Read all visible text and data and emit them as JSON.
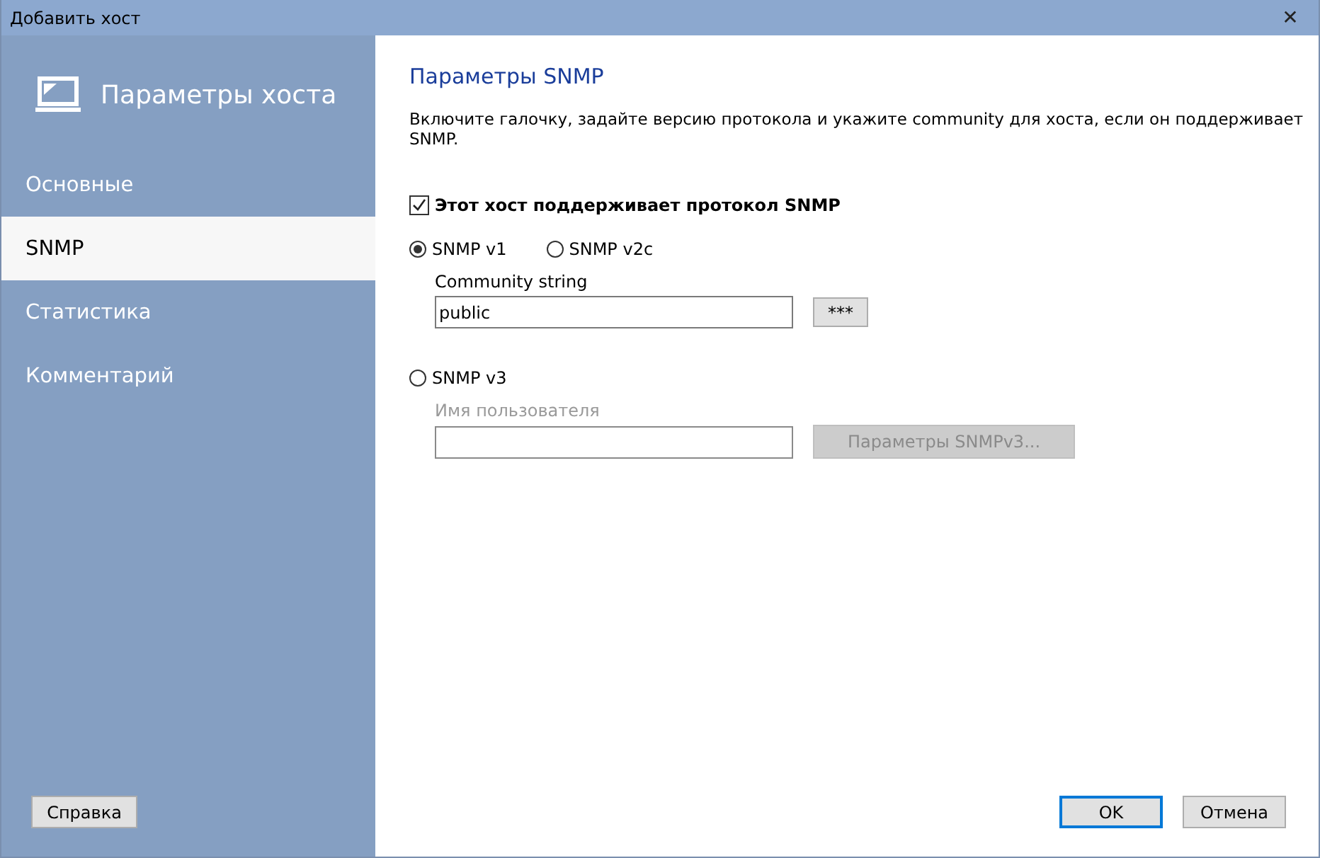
{
  "window": {
    "title": "Добавить хост",
    "close": "✕"
  },
  "sidebar": {
    "heading": "Параметры хоста",
    "items": [
      {
        "label": "Основные",
        "selected": false
      },
      {
        "label": "SNMP",
        "selected": true
      },
      {
        "label": "Статистика",
        "selected": false
      },
      {
        "label": "Комментарий",
        "selected": false
      }
    ],
    "help_button": "Справка"
  },
  "content": {
    "title": "Параметры SNMP",
    "description": "Включите галочку, задайте версию протокола и укажите community для хоста,  если он поддерживает SNMP.",
    "snmp_checkbox": {
      "label": "Этот хост поддерживает протокол SNMP",
      "checked": true
    },
    "versions": [
      {
        "label": "SNMP v1",
        "selected": true
      },
      {
        "label": "SNMP v2c",
        "selected": false
      },
      {
        "label": "SNMP v3",
        "selected": false
      }
    ],
    "community": {
      "label": "Community string",
      "value": "public",
      "disabled": false,
      "button": "***"
    },
    "user": {
      "label": "Имя пользователя",
      "disabled": true,
      "button": "Параметры SNMPv3..."
    }
  },
  "buttons": [
    {
      "label": "OK",
      "default": true
    },
    {
      "label": "Отмена",
      "default": false
    }
  ]
}
